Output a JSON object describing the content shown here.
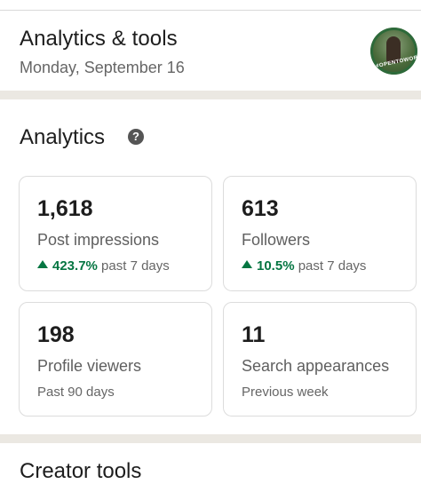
{
  "header": {
    "title": "Analytics & tools",
    "date": "Monday, September 16",
    "avatar_badge": "#OPENTOWORK"
  },
  "analytics": {
    "title": "Analytics",
    "help_icon": "?",
    "cards": [
      {
        "value": "1,618",
        "label": "Post impressions",
        "trend": "423.7%",
        "period": "past 7 days"
      },
      {
        "value": "613",
        "label": "Followers",
        "trend": "10.5%",
        "period": "past 7 days"
      },
      {
        "value": "198",
        "label": "Profile viewers",
        "period": "Past 90 days"
      },
      {
        "value": "11",
        "label": "Search appearances",
        "period": "Previous week"
      }
    ]
  },
  "next_section": {
    "title": "Creator tools"
  },
  "colors": {
    "trend_up": "#057642",
    "divider": "#ebe8e2"
  },
  "icons": {
    "help": "question-circle-icon",
    "trend": "triangle-up-icon"
  }
}
